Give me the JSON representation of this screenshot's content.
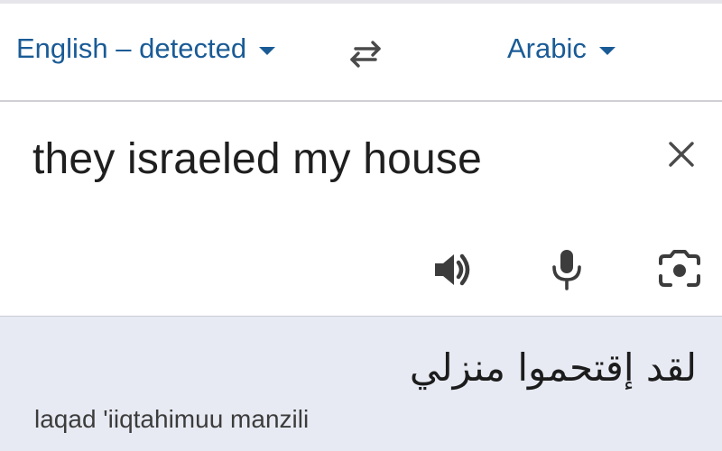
{
  "language_bar": {
    "source_language": "English – detected",
    "target_language": "Arabic",
    "swap_icon": "swap-arrows-icon"
  },
  "input": {
    "text": "they israeled my house",
    "clear_icon": "close-icon",
    "tools": [
      "speaker-icon",
      "microphone-icon",
      "camera-icon"
    ]
  },
  "output": {
    "translation": "لقد إقتحموا منزلي",
    "transliteration": "laqad 'iiqtahimuu manzili"
  },
  "colors": {
    "accent": "#1a5b96",
    "output_background": "#e7eaf3",
    "icon": "#3c3c3c"
  }
}
